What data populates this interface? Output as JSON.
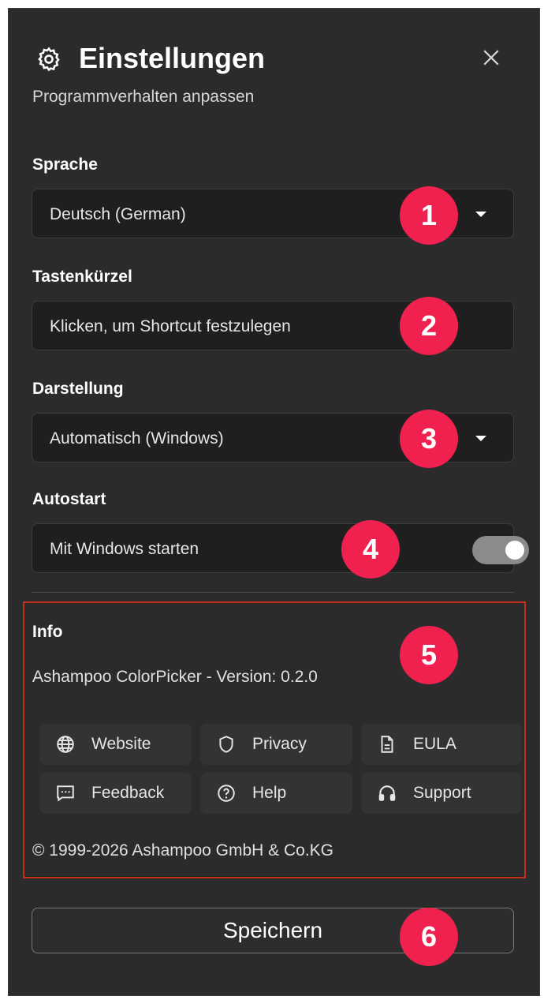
{
  "header": {
    "title": "Einstellungen",
    "subtitle": "Programmverhalten anpassen",
    "icon": "gear-icon",
    "close_icon": "close-icon"
  },
  "language": {
    "label": "Sprache",
    "value": "Deutsch (German)"
  },
  "shortcut": {
    "label": "Tastenkürzel",
    "placeholder": "Klicken, um Shortcut festzulegen"
  },
  "appearance": {
    "label": "Darstellung",
    "value": "Automatisch (Windows)"
  },
  "autostart": {
    "label": "Autostart",
    "option_label": "Mit Windows starten",
    "enabled": true
  },
  "info": {
    "title": "Info",
    "version_text": "Ashampoo ColorPicker - Version: 0.2.0",
    "links": [
      {
        "label": "Website",
        "icon": "globe-icon"
      },
      {
        "label": "Privacy",
        "icon": "shield-icon"
      },
      {
        "label": "EULA",
        "icon": "document-icon"
      },
      {
        "label": "Feedback",
        "icon": "chat-icon"
      },
      {
        "label": "Help",
        "icon": "help-icon"
      },
      {
        "label": "Support",
        "icon": "headset-icon"
      }
    ],
    "copyright": "© 1999-2026 Ashampoo GmbH & Co.KG"
  },
  "footer": {
    "save_label": "Speichern"
  },
  "annotations": [
    "1",
    "2",
    "3",
    "4",
    "5",
    "6"
  ],
  "colors": {
    "window_bg": "#2b2b2b",
    "field_bg": "#1f1f1f",
    "badge": "#f0204f",
    "highlight_border": "#c0311f"
  }
}
